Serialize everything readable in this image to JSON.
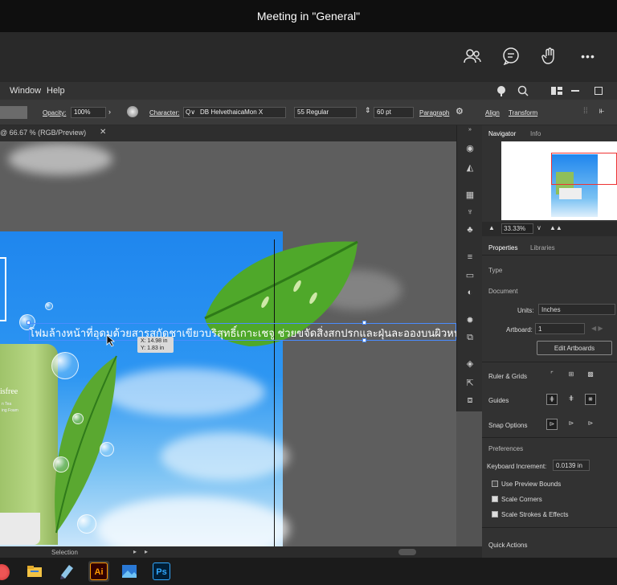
{
  "teams": {
    "meeting_title": "Meeting in \"General\"",
    "more_label": "•••"
  },
  "illustrator": {
    "menu": [
      "Window",
      "Help"
    ],
    "control": {
      "opacity_label": "Opacity:",
      "opacity_value": "100%",
      "character_label": "Character:",
      "font_name": "DB HelvethaicaMon X",
      "font_style": "55 Regular",
      "font_size": "60 pt",
      "paragraph_label": "Paragraph",
      "align_label": "Align",
      "transform_label": "Transform"
    },
    "doc_tab": "@ 66.67 % (RGB/Preview)",
    "canvas": {
      "headline_text": "โฟมล้างหน้าที่อุดมด้วยสารสกัดชาเขียวบริสุทธิ์เกาะเชจู ช่วยขจัดสิ่งสกปรกและฝุ่นละอองบนผิวหน้าไ",
      "coord_x": "X: 14.98 in",
      "coord_y": "Y: 1.83 in",
      "tube_brand": "isfree",
      "tube_line1": "n Tea",
      "tube_line2": "ing Foam"
    },
    "status": {
      "tool_name": "Selection"
    },
    "panel": {
      "tabs_top": [
        "Navigator",
        "Info"
      ],
      "zoom": "33.33%",
      "tabs_mid": [
        "Properties",
        "Libraries"
      ],
      "type_label": "Type",
      "document_label": "Document",
      "units_label": "Units:",
      "units_value": "Inches",
      "artboard_label": "Artboard:",
      "artboard_value": "1",
      "edit_artboards": "Edit Artboards",
      "ruler_grids": "Ruler & Grids",
      "guides": "Guides",
      "snap_options": "Snap Options",
      "preferences": "Preferences",
      "keyboard_increment_label": "Keyboard Increment:",
      "keyboard_increment_value": "0.0139 in",
      "use_preview_bounds": "Use Preview Bounds",
      "scale_corners": "Scale Corners",
      "scale_strokes": "Scale Strokes & Effects",
      "quick_actions": "Quick Actions",
      "checkboxes": {
        "use_preview_bounds": false,
        "scale_corners": true,
        "scale_strokes": true
      }
    }
  },
  "taskbar": {
    "ai_label": "Ai",
    "ps_label": "Ps"
  },
  "colors": {
    "artboard_blue": "#1f86ee",
    "leaf_green": "#4fa82a",
    "ai_orange": "#ff9a00",
    "ps_blue": "#31a8ff"
  }
}
